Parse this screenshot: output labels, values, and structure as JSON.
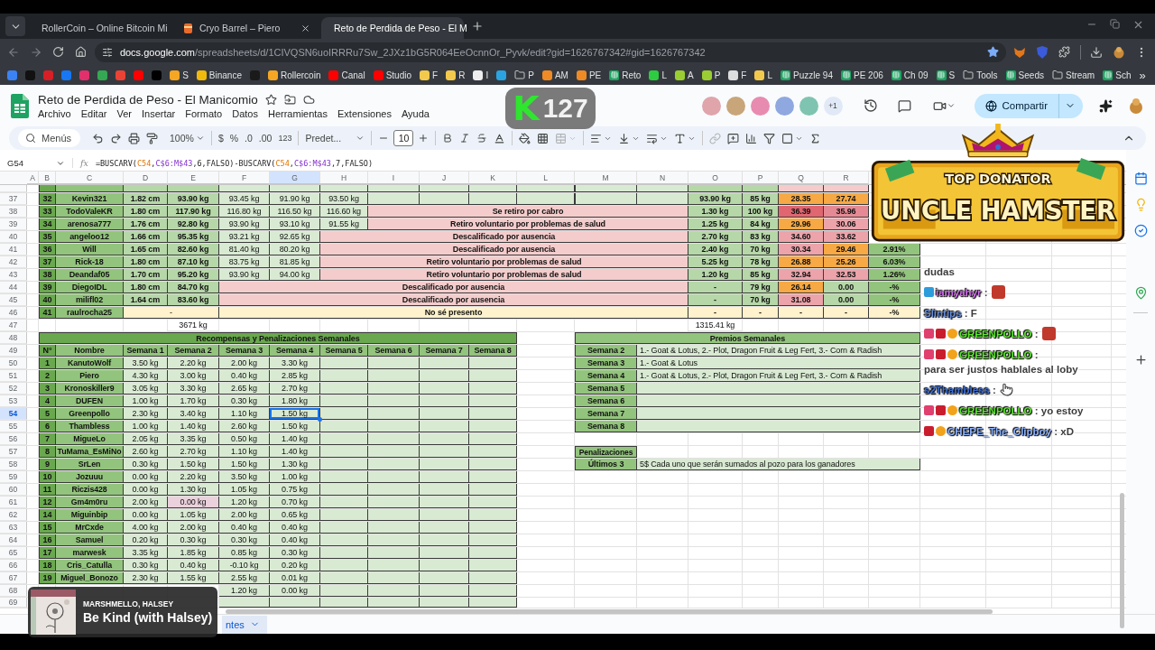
{
  "browser": {
    "tabs": [
      {
        "title": "RollerCoin – Online Bitcoin Mi",
        "selected": false
      },
      {
        "title": "Cryo Barrel – Piero",
        "selected": false
      },
      {
        "title": "Reto de Perdida de Peso - El M",
        "selected": true
      }
    ],
    "url": {
      "domain": "docs.google.com",
      "path": "/spreadsheets/d/1CIVQSN6uoIRRRu7Sw_2JXz1bG5R064EeOcnnOr_Pyvk/edit?gid=1626767342#gid=1626767342"
    },
    "bookmarks": [
      {
        "kind": "site",
        "color": "#3b82f6"
      },
      {
        "kind": "site",
        "color": "#111111"
      },
      {
        "kind": "site",
        "color": "#d81f26"
      },
      {
        "kind": "site",
        "color": "#1877f2"
      },
      {
        "kind": "site",
        "color": "#e1306c"
      },
      {
        "kind": "site",
        "color": "#34a853"
      },
      {
        "kind": "site",
        "color": "#ea4335"
      },
      {
        "kind": "site",
        "color": "#ff0000"
      },
      {
        "kind": "site",
        "color": "#000000"
      },
      {
        "kind": "site",
        "color": "#f5a623",
        "label": "S"
      },
      {
        "kind": "site",
        "color": "#f0b90b",
        "label": "Binance"
      },
      {
        "kind": "site",
        "color": "#1a1a1a"
      },
      {
        "kind": "site",
        "color": "#f5a623",
        "label": "Rollercoin"
      },
      {
        "kind": "site",
        "color": "#ff0000",
        "label": "Canal"
      },
      {
        "kind": "site",
        "color": "#ff0000",
        "label": "Studio"
      },
      {
        "kind": "site",
        "color": "#f2c94c",
        "label": "F"
      },
      {
        "kind": "site",
        "color": "#f2c94c",
        "label": "R"
      },
      {
        "kind": "site",
        "color": "#eeeeee",
        "label": "I"
      },
      {
        "kind": "site",
        "color": "#2aa3e0"
      },
      {
        "kind": "folder",
        "label": "P"
      },
      {
        "kind": "site",
        "color": "#f08a24",
        "label": "AM"
      },
      {
        "kind": "site",
        "color": "#f08a24",
        "label": "PE"
      },
      {
        "kind": "sheet",
        "label": "Reto"
      },
      {
        "kind": "site",
        "color": "#2ecc40",
        "label": "L"
      },
      {
        "kind": "site",
        "color": "#9acd32",
        "label": "A"
      },
      {
        "kind": "site",
        "color": "#9acd32",
        "label": "P"
      },
      {
        "kind": "site",
        "color": "#dddddd",
        "label": "F"
      },
      {
        "kind": "site",
        "color": "#f2c94c",
        "label": "L"
      },
      {
        "kind": "sheet",
        "label": "Puzzle 94"
      },
      {
        "kind": "sheet",
        "label": "PE 206"
      },
      {
        "kind": "sheet",
        "label": "Ch 09"
      },
      {
        "kind": "sheet",
        "label": "S"
      },
      {
        "kind": "folder",
        "label": "Tools"
      },
      {
        "kind": "sheet",
        "label": "Seeds"
      },
      {
        "kind": "folder",
        "label": "Stream"
      },
      {
        "kind": "sheet",
        "label": "Sch"
      }
    ],
    "more": "»"
  },
  "doc": {
    "title": "Reto de Perdida de Peso - El Manicomio",
    "menus": [
      "Archivo",
      "Editar",
      "Ver",
      "Insertar",
      "Formato",
      "Datos",
      "Herramientas",
      "Extensiones",
      "Ayuda"
    ],
    "collaborators": [
      {
        "color": "#e0a4ab"
      },
      {
        "color": "#c9a57a"
      },
      {
        "color": "#e88bb0"
      },
      {
        "color": "#8fa8e0"
      },
      {
        "color": "#7fc4b0"
      }
    ],
    "extra_collaborators": "+1",
    "share": "Compartir"
  },
  "toolbar": {
    "search": "Menús",
    "zoom": "100%",
    "currency": "$",
    "percent": "%",
    "decrease_decimals": ".0",
    "increase_decimals": ".00",
    "number_format": "123",
    "font": "Predet...",
    "font_size": "10"
  },
  "formula_bar": {
    "cell": "G54",
    "label": "fx",
    "parts": [
      {
        "kind": "plain",
        "text": "=BUSCARV("
      },
      {
        "kind": "ref_a",
        "text": "C54"
      },
      {
        "kind": "plain",
        "text": ","
      },
      {
        "kind": "ref_b",
        "text": "C$6:M$43"
      },
      {
        "kind": "plain",
        "text": ",6,FALSO)-BUSCARV("
      },
      {
        "kind": "ref_a",
        "text": "C54"
      },
      {
        "kind": "plain",
        "text": ","
      },
      {
        "kind": "ref_b",
        "text": "C$6:M$43"
      },
      {
        "kind": "plain",
        "text": ",7,FALSO)"
      }
    ]
  },
  "sheet": {
    "columns": [
      {
        "label": "A",
        "selected": false
      },
      {
        "label": "B",
        "selected": false
      },
      {
        "label": "C",
        "selected": false
      },
      {
        "label": "D",
        "selected": false
      },
      {
        "label": "E",
        "selected": false
      },
      {
        "label": "F",
        "selected": false
      },
      {
        "label": "G",
        "selected": true
      },
      {
        "label": "H",
        "selected": false
      },
      {
        "label": "I",
        "selected": false
      },
      {
        "label": "J",
        "selected": false
      },
      {
        "label": "K",
        "selected": false
      },
      {
        "label": "L",
        "selected": false
      },
      {
        "label": "M",
        "selected": false
      },
      {
        "label": "N",
        "selected": false
      },
      {
        "label": "O",
        "selected": false
      },
      {
        "label": "P",
        "selected": false
      },
      {
        "label": "Q",
        "selected": false
      },
      {
        "label": "R",
        "selected": false
      }
    ],
    "row_numbers": [
      {
        "label": "37",
        "selected": false
      },
      {
        "label": "38",
        "selected": false
      },
      {
        "label": "39",
        "selected": false
      },
      {
        "label": "40",
        "selected": false
      },
      {
        "label": "41",
        "selected": false
      },
      {
        "label": "42",
        "selected": false
      },
      {
        "label": "43",
        "selected": false
      },
      {
        "label": "44",
        "selected": false
      },
      {
        "label": "45",
        "selected": false
      },
      {
        "label": "46",
        "selected": false
      },
      {
        "label": "47",
        "selected": false
      },
      {
        "label": "48",
        "selected": false
      },
      {
        "label": "49",
        "selected": false
      },
      {
        "label": "50",
        "selected": false
      },
      {
        "label": "51",
        "selected": false
      },
      {
        "label": "52",
        "selected": false
      },
      {
        "label": "53",
        "selected": false
      },
      {
        "label": "54",
        "selected": true
      },
      {
        "label": "55",
        "selected": false
      },
      {
        "label": "56",
        "selected": false
      },
      {
        "label": "57",
        "selected": false
      },
      {
        "label": "58",
        "selected": false
      },
      {
        "label": "59",
        "selected": false
      },
      {
        "label": "60",
        "selected": false
      },
      {
        "label": "61",
        "selected": false
      },
      {
        "label": "62",
        "selected": false
      },
      {
        "label": "63",
        "selected": false
      },
      {
        "label": "64",
        "selected": false
      },
      {
        "label": "65",
        "selected": false
      },
      {
        "label": "66",
        "selected": false
      },
      {
        "label": "67",
        "selected": false
      },
      {
        "label": "68",
        "selected": false
      },
      {
        "label": "69",
        "selected": false
      }
    ],
    "weigh_ins": [
      {
        "kind": "active",
        "num": "32",
        "name": "Kevin321",
        "height": "1.82 cm",
        "start": "93.90 kg",
        "weeks": [
          "93.45 kg",
          "91.90 kg",
          "93.50 kg"
        ],
        "lost": "93.90 kg",
        "goal": "85 kg",
        "bmi": [
          {
            "value": "28.35",
            "color": "#f6a944"
          },
          {
            "value": "27.74",
            "color": "#f6a944"
          }
        ]
      },
      {
        "kind": "active",
        "num": "33",
        "name": "TodoValeKR",
        "height": "1.80 cm",
        "start": "117.90 kg",
        "weeks": [
          "116.80 kg",
          "116.50 kg",
          "116.60 kg"
        ],
        "status": "Se retiro por cabro",
        "lost": "1.30 kg",
        "goal": "100 kg",
        "bmi": [
          {
            "value": "36.39",
            "color": "#e06670"
          },
          {
            "value": "35.96",
            "color": "#e58a94"
          }
        ]
      },
      {
        "kind": "active",
        "num": "34",
        "name": "arenosa777",
        "height": "1.76 cm",
        "start": "92.80 kg",
        "weeks": [
          "93.90 kg",
          "93.10 kg",
          "91.55 kg"
        ],
        "status": "Retiro voluntario por problemas de salud",
        "lost": "1.25 kg",
        "goal": "84 kg",
        "bmi": [
          {
            "value": "29.96",
            "color": "#f6a944"
          },
          {
            "value": "30.06",
            "color": "#eca3aa"
          }
        ]
      },
      {
        "kind": "active",
        "num": "35",
        "name": "angeloo12",
        "height": "1.66 cm",
        "start": "95.35 kg",
        "weeks": [
          "93.21 kg",
          "92.65 kg"
        ],
        "status": "Descalificado por ausencia",
        "lost": "2.70 kg",
        "goal": "83 kg",
        "bmi": [
          {
            "value": "34.60",
            "color": "#eca3aa"
          },
          {
            "value": "33.62",
            "color": "#eca3aa"
          }
        ]
      },
      {
        "kind": "active",
        "num": "36",
        "name": "Will",
        "height": "1.65 cm",
        "start": "82.60 kg",
        "weeks": [
          "81.40 kg",
          "80.20 kg"
        ],
        "status": "Descalificado por ausencia",
        "lost": "2.40 kg",
        "goal": "70 kg",
        "bmi": [
          {
            "value": "30.34",
            "color": "#eca3aa"
          },
          {
            "value": "29.46",
            "color": "#f6a944"
          }
        ],
        "pct": "2.91%"
      },
      {
        "kind": "active",
        "num": "37",
        "name": "Rick-18",
        "height": "1.80 cm",
        "start": "87.10 kg",
        "weeks": [
          "83.75 kg",
          "81.85 kg"
        ],
        "status": "Retiro voluntario por problemas de salud",
        "lost": "5.25 kg",
        "goal": "78 kg",
        "bmi": [
          {
            "value": "26.88",
            "color": "#f6a944"
          },
          {
            "value": "25.26",
            "color": "#f6a944"
          }
        ],
        "pct": "6.03%"
      },
      {
        "kind": "active",
        "num": "38",
        "name": "Deandaf05",
        "height": "1.70 cm",
        "start": "95.20 kg",
        "weeks": [
          "93.90 kg",
          "94.00 kg"
        ],
        "status": "Retiro voluntario por problemas de salud",
        "lost": "1.20 kg",
        "goal": "85 kg",
        "bmi": [
          {
            "value": "32.94",
            "color": "#eca3aa"
          },
          {
            "value": "32.53",
            "color": "#eca3aa"
          }
        ],
        "pct": "1.26%"
      },
      {
        "kind": "active",
        "num": "39",
        "name": "DiegoIDL",
        "height": "1.80 cm",
        "start": "84.70 kg",
        "status": "Descalificado por ausencia",
        "lost": "-",
        "goal": "79 kg",
        "bmi": [
          {
            "value": "26.14",
            "color": "#f6a944"
          },
          {
            "value": "0.00",
            "color": "#b6d7a8"
          }
        ],
        "pct": "-%"
      },
      {
        "kind": "active",
        "num": "40",
        "name": "milifl02",
        "height": "1.64 cm",
        "start": "83.60 kg",
        "status": "Descalificado por ausencia",
        "lost": "-",
        "goal": "70 kg",
        "bmi": [
          {
            "value": "31.08",
            "color": "#eca3aa"
          },
          {
            "value": "0.00",
            "color": "#b6d7a8"
          }
        ],
        "pct": "-%"
      },
      {
        "kind": "absent",
        "num": "41",
        "name": "raulrocha25",
        "dash": "-",
        "status": "No sé presento",
        "lost": "-",
        "goal": "-",
        "bmi": [
          {
            "value": "-",
            "color": "#fff2cc"
          },
          {
            "value": "-",
            "color": "#fff2cc"
          }
        ],
        "pct": "-%"
      }
    ],
    "totals": {
      "start_weight": "3671 kg",
      "lost": "1315.41 kg"
    },
    "rewards": {
      "title": "Recompensas y Penalizaciones Semanales",
      "headers": [
        "N°",
        "Nombre",
        "Semana 1",
        "Semana 2",
        "Semana 3",
        "Semana 4",
        "Semana 5",
        "Semana 6",
        "Semana 7",
        "Semana 8"
      ],
      "rows": [
        {
          "kind": "full",
          "num": "1",
          "name": "KanutoWolf",
          "weeks": [
            {
              "value": "3.50 kg",
              "flagged": false,
              "selected": false
            },
            {
              "value": "2.20 kg",
              "flagged": false,
              "selected": false
            },
            {
              "value": "2.00 kg",
              "flagged": false,
              "selected": false
            },
            {
              "value": "3.30 kg",
              "flagged": false,
              "selected": false
            }
          ]
        },
        {
          "kind": "full",
          "num": "2",
          "name": "Piero",
          "weeks": [
            {
              "value": "4.30 kg",
              "flagged": false,
              "selected": false
            },
            {
              "value": "3.00 kg",
              "flagged": false,
              "selected": false
            },
            {
              "value": "0.40 kg",
              "flagged": false,
              "selected": false
            },
            {
              "value": "2.85 kg",
              "flagged": false,
              "selected": false
            }
          ]
        },
        {
          "kind": "full",
          "num": "3",
          "name": "Kronoskiller9",
          "weeks": [
            {
              "value": "3.05 kg",
              "flagged": false,
              "selected": false
            },
            {
              "value": "3.30 kg",
              "flagged": false,
              "selected": false
            },
            {
              "value": "2.65 kg",
              "flagged": false,
              "selected": false
            },
            {
              "value": "2.70 kg",
              "flagged": false,
              "selected": false
            }
          ]
        },
        {
          "kind": "full",
          "num": "4",
          "name": "DUFEN",
          "weeks": [
            {
              "value": "1.00 kg",
              "flagged": false,
              "selected": false
            },
            {
              "value": "1.70 kg",
              "flagged": false,
              "selected": false
            },
            {
              "value": "0.30 kg",
              "flagged": false,
              "selected": false
            },
            {
              "value": "1.80 kg",
              "flagged": false,
              "selected": false
            }
          ]
        },
        {
          "kind": "full",
          "num": "5",
          "name": "Greenpollo",
          "weeks": [
            {
              "value": "2.30 kg",
              "flagged": false,
              "selected": false
            },
            {
              "value": "3.40 kg",
              "flagged": false,
              "selected": false
            },
            {
              "value": "1.10 kg",
              "flagged": false,
              "selected": false
            },
            {
              "value": "1.50 kg",
              "flagged": false,
              "selected": true
            }
          ]
        },
        {
          "kind": "full",
          "num": "6",
          "name": "Thambless",
          "weeks": [
            {
              "value": "1.00 kg",
              "flagged": false,
              "selected": false
            },
            {
              "value": "1.40 kg",
              "flagged": false,
              "selected": false
            },
            {
              "value": "2.60 kg",
              "flagged": false,
              "selected": false
            },
            {
              "value": "1.50 kg",
              "flagged": false,
              "selected": false
            }
          ]
        },
        {
          "kind": "full",
          "num": "7",
          "name": "MigueLo",
          "weeks": [
            {
              "value": "2.05 kg",
              "flagged": false,
              "selected": false
            },
            {
              "value": "3.35 kg",
              "flagged": false,
              "selected": false
            },
            {
              "value": "0.50 kg",
              "flagged": false,
              "selected": false
            },
            {
              "value": "1.40 kg",
              "flagged": false,
              "selected": false
            }
          ]
        },
        {
          "kind": "full",
          "num": "8",
          "name": "TuMama_EsMiNo",
          "weeks": [
            {
              "value": "2.60 kg",
              "flagged": false,
              "selected": false
            },
            {
              "value": "2.70 kg",
              "flagged": false,
              "selected": false
            },
            {
              "value": "1.10 kg",
              "flagged": false,
              "selected": false
            },
            {
              "value": "1.40 kg",
              "flagged": false,
              "selected": false
            }
          ]
        },
        {
          "kind": "full",
          "num": "9",
          "name": "SrLen",
          "weeks": [
            {
              "value": "0.30 kg",
              "flagged": false,
              "selected": false
            },
            {
              "value": "1.50 kg",
              "flagged": false,
              "selected": false
            },
            {
              "value": "1.50 kg",
              "flagged": false,
              "selected": false
            },
            {
              "value": "1.30 kg",
              "flagged": false,
              "selected": false
            }
          ]
        },
        {
          "kind": "full",
          "num": "10",
          "name": "Jozuuu",
          "weeks": [
            {
              "value": "0.00 kg",
              "flagged": false,
              "selected": false
            },
            {
              "value": "2.20 kg",
              "flagged": false,
              "selected": false
            },
            {
              "value": "3.50 kg",
              "flagged": false,
              "selected": false
            },
            {
              "value": "1.00 kg",
              "flagged": false,
              "selected": false
            }
          ]
        },
        {
          "kind": "full",
          "num": "11",
          "name": "Riczis428",
          "weeks": [
            {
              "value": "0.00 kg",
              "flagged": false,
              "selected": false
            },
            {
              "value": "1.30 kg",
              "flagged": false,
              "selected": false
            },
            {
              "value": "1.05 kg",
              "flagged": false,
              "selected": false
            },
            {
              "value": "0.75 kg",
              "flagged": false,
              "selected": false
            }
          ]
        },
        {
          "kind": "full",
          "num": "12",
          "name": "Gm4m0ru",
          "weeks": [
            {
              "value": "2.00 kg",
              "flagged": false,
              "selected": false
            },
            {
              "value": "0.00 kg",
              "flagged": true,
              "selected": false
            },
            {
              "value": "1.20 kg",
              "flagged": false,
              "selected": false
            },
            {
              "value": "0.70 kg",
              "flagged": false,
              "selected": false
            }
          ]
        },
        {
          "kind": "full",
          "num": "14",
          "name": "Miguinbip",
          "weeks": [
            {
              "value": "0.00 kg",
              "flagged": false,
              "selected": false
            },
            {
              "value": "1.05 kg",
              "flagged": false,
              "selected": false
            },
            {
              "value": "2.00 kg",
              "flagged": false,
              "selected": false
            },
            {
              "value": "0.65 kg",
              "flagged": false,
              "selected": false
            }
          ]
        },
        {
          "kind": "full",
          "num": "15",
          "name": "MrCxde",
          "weeks": [
            {
              "value": "4.00 kg",
              "flagged": false,
              "selected": false
            },
            {
              "value": "2.00 kg",
              "flagged": false,
              "selected": false
            },
            {
              "value": "0.40 kg",
              "flagged": false,
              "selected": false
            },
            {
              "value": "0.40 kg",
              "flagged": false,
              "selected": false
            }
          ]
        },
        {
          "kind": "full",
          "num": "16",
          "name": "Samuel",
          "weeks": [
            {
              "value": "0.20 kg",
              "flagged": false,
              "selected": false
            },
            {
              "value": "0.30 kg",
              "flagged": false,
              "selected": false
            },
            {
              "value": "0.30 kg",
              "flagged": false,
              "selected": false
            },
            {
              "value": "0.40 kg",
              "flagged": false,
              "selected": false
            }
          ]
        },
        {
          "kind": "full",
          "num": "17",
          "name": "marwesk",
          "weeks": [
            {
              "value": "3.35 kg",
              "flagged": false,
              "selected": false
            },
            {
              "value": "1.85 kg",
              "flagged": false,
              "selected": false
            },
            {
              "value": "0.85 kg",
              "flagged": false,
              "selected": false
            },
            {
              "value": "0.30 kg",
              "flagged": false,
              "selected": false
            }
          ]
        },
        {
          "kind": "full",
          "num": "18",
          "name": "Cris_Catulla",
          "weeks": [
            {
              "value": "0.30 kg",
              "flagged": false,
              "selected": false
            },
            {
              "value": "0.40 kg",
              "flagged": false,
              "selected": false
            },
            {
              "value": "-0.10 kg",
              "flagged": false,
              "selected": false
            },
            {
              "value": "0.20 kg",
              "flagged": false,
              "selected": false
            }
          ]
        },
        {
          "kind": "full",
          "num": "19",
          "name": "Miguel_Bonozo",
          "weeks": [
            {
              "value": "2.30 kg",
              "flagged": false,
              "selected": false
            },
            {
              "value": "1.55 kg",
              "flagged": false,
              "selected": false
            },
            {
              "value": "2.55 kg",
              "flagged": false,
              "selected": false
            },
            {
              "value": "0.01 kg",
              "flagged": false,
              "selected": false
            }
          ]
        },
        {
          "kind": "partial",
          "weeks": [
            {
              "value": "1.20 kg",
              "flagged": false,
              "selected": false
            },
            {
              "value": "0.00 kg",
              "flagged": false,
              "selected": false
            }
          ]
        }
      ]
    },
    "prizes": {
      "title": "Premios Semanales",
      "rows": [
        {
          "label": "Semana 2",
          "text": "1.- Goat & Lotus, 2.- Plot, Dragon Fruit & Leg Fert, 3.- Corn & Radish"
        },
        {
          "label": "Semana 3",
          "text": "1.- Goat & Lotus"
        },
        {
          "label": "Semana 4",
          "text": "1.- Goat & Lotus, 2.- Plot, Dragon Fruit & Leg Fert, 3.- Corn & Radish"
        },
        {
          "label": "Semana 5"
        },
        {
          "label": "Semana 6"
        },
        {
          "label": "Semana 7"
        },
        {
          "label": "Semana 8"
        }
      ]
    },
    "penalties": {
      "title": "Penalizaciones",
      "rows": [
        {
          "label": "Últimos 3",
          "text": "5$ Cada uno que serán sumados al pozo para los ganadores"
        }
      ]
    }
  },
  "sheet_tab": {
    "label": "ntes"
  },
  "overlays": {
    "badge": {
      "logo": "K",
      "count": "127"
    },
    "banner": {
      "title": "TOP DONATOR",
      "name": "UNCLE HAMSTER"
    },
    "chat": [
      {
        "kind": "continuation",
        "text": "dudas"
      },
      {
        "kind": "message",
        "name": "iamyahyr",
        "color": "#d46ef0",
        "separator": ":",
        "profile_badge": true,
        "face_emote": true
      },
      {
        "kind": "message",
        "name": "Slintips",
        "color": "#6a8fd8",
        "separator": ":",
        "text": "F"
      },
      {
        "kind": "message",
        "name": "GREENPOLLO",
        "color": "#5ee82f",
        "separator": ":",
        "cube_badge": true,
        "vip_badge": true,
        "coin_badge": true,
        "face_emote": true
      },
      {
        "kind": "message",
        "name": "GREENPOLLO",
        "color": "#5ee82f",
        "separator": ":",
        "cube_badge": true,
        "vip_badge": true,
        "coin_badge": true,
        "text": "para ser justos hablales al loby"
      },
      {
        "kind": "message",
        "name": "s2Thambless",
        "color": "#3d6fd6",
        "separator": ":",
        "hand_emote": true
      },
      {
        "kind": "message",
        "name": "GREENPOLLO",
        "color": "#5ee82f",
        "separator": ":",
        "cube_badge": true,
        "vip_badge": true,
        "coin_badge": true,
        "text": "yo estoy"
      },
      {
        "kind": "message",
        "name": "CHEPE_The_Clipboy",
        "color": "#8db3ff",
        "separator": ":",
        "vip_badge": true,
        "coin_badge": true,
        "text": "xD"
      }
    ],
    "now_playing": {
      "artist": "MARSHMELLO, HALSEY",
      "song": "Be Kind (with Halsey)"
    }
  }
}
